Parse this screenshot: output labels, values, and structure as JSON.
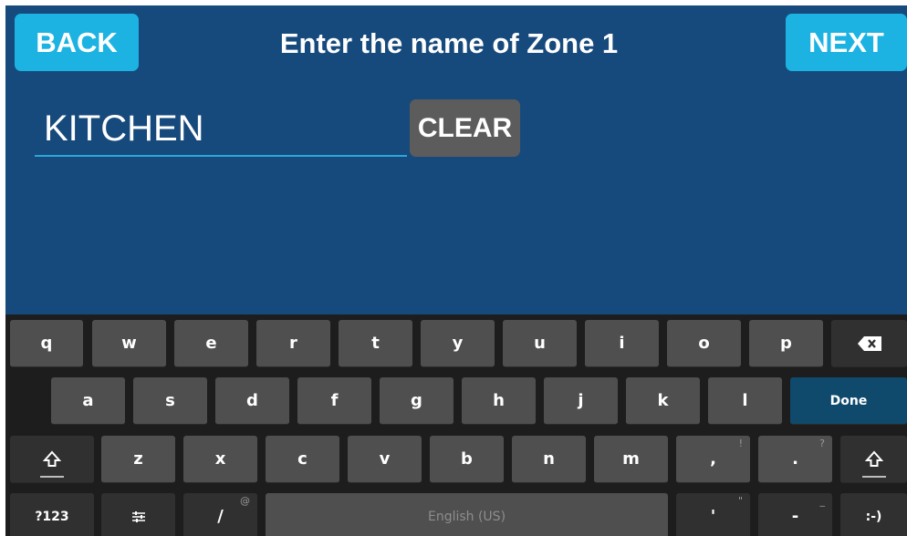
{
  "header": {
    "back_label": "BACK",
    "title": "Enter the name of Zone 1",
    "next_label": "NEXT"
  },
  "name_input": {
    "value": "KITCHEN"
  },
  "clear_label": "CLEAR",
  "keyboard": {
    "row1": [
      "q",
      "w",
      "e",
      "r",
      "t",
      "y",
      "u",
      "i",
      "o",
      "p"
    ],
    "row2": [
      "a",
      "s",
      "d",
      "f",
      "g",
      "h",
      "j",
      "k",
      "l"
    ],
    "done_label": "Done",
    "row3": [
      "z",
      "x",
      "c",
      "v",
      "b",
      "n",
      "m"
    ],
    "comma": {
      "main": ",",
      "alt": "!"
    },
    "period": {
      "main": ".",
      "alt": "?"
    },
    "symbols_label": "?123",
    "slash": {
      "main": "/",
      "alt": "@"
    },
    "space_label": "English (US)",
    "apostrophe": {
      "main": "'",
      "alt": "\""
    },
    "dash": {
      "main": "-",
      "alt": "_"
    },
    "smiley_label": ":-)",
    "icons": [
      "backspace-icon",
      "shift-icon",
      "settings-sliders-icon"
    ]
  },
  "colors": {
    "background": "#174a7c",
    "accent": "#1cb3e3",
    "clear_button": "#5c5c5c",
    "keyboard": "#1d1d1d",
    "key": "#4f4f4f",
    "done_key": "#0f4a6d"
  }
}
